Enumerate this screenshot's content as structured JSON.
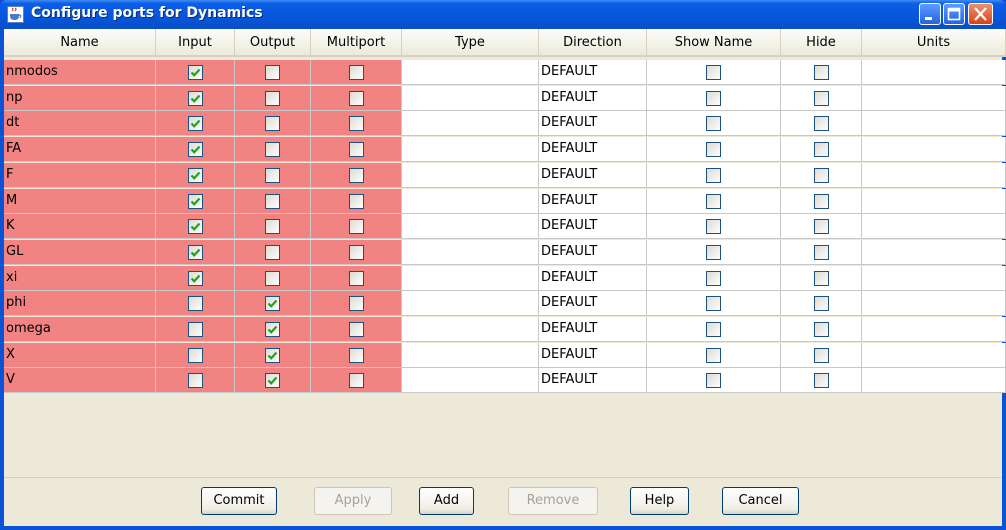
{
  "window": {
    "title": "Configure ports for Dynamics"
  },
  "columns": [
    "Name",
    "Input",
    "Output",
    "Multiport",
    "Type",
    "Direction",
    "Show Name",
    "Hide",
    "Units"
  ],
  "rows": [
    {
      "name": "nmodos",
      "input": true,
      "output": false,
      "multiport": false,
      "type": "",
      "direction": "DEFAULT",
      "show_name": false,
      "hide": false,
      "units": ""
    },
    {
      "name": "np",
      "input": true,
      "output": false,
      "multiport": false,
      "type": "",
      "direction": "DEFAULT",
      "show_name": false,
      "hide": false,
      "units": ""
    },
    {
      "name": "dt",
      "input": true,
      "output": false,
      "multiport": false,
      "type": "",
      "direction": "DEFAULT",
      "show_name": false,
      "hide": false,
      "units": ""
    },
    {
      "name": "FA",
      "input": true,
      "output": false,
      "multiport": false,
      "type": "",
      "direction": "DEFAULT",
      "show_name": false,
      "hide": false,
      "units": ""
    },
    {
      "name": "F",
      "input": true,
      "output": false,
      "multiport": false,
      "type": "",
      "direction": "DEFAULT",
      "show_name": false,
      "hide": false,
      "units": ""
    },
    {
      "name": "M",
      "input": true,
      "output": false,
      "multiport": false,
      "type": "",
      "direction": "DEFAULT",
      "show_name": false,
      "hide": false,
      "units": ""
    },
    {
      "name": "K",
      "input": true,
      "output": false,
      "multiport": false,
      "type": "",
      "direction": "DEFAULT",
      "show_name": false,
      "hide": false,
      "units": ""
    },
    {
      "name": "GL",
      "input": true,
      "output": false,
      "multiport": false,
      "type": "",
      "direction": "DEFAULT",
      "show_name": false,
      "hide": false,
      "units": ""
    },
    {
      "name": "xi",
      "input": true,
      "output": false,
      "multiport": false,
      "type": "",
      "direction": "DEFAULT",
      "show_name": false,
      "hide": false,
      "units": ""
    },
    {
      "name": "phi",
      "input": false,
      "output": true,
      "multiport": false,
      "type": "",
      "direction": "DEFAULT",
      "show_name": false,
      "hide": false,
      "units": ""
    },
    {
      "name": "omega",
      "input": false,
      "output": true,
      "multiport": false,
      "type": "",
      "direction": "DEFAULT",
      "show_name": false,
      "hide": false,
      "units": ""
    },
    {
      "name": "X",
      "input": false,
      "output": true,
      "multiport": false,
      "type": "",
      "direction": "DEFAULT",
      "show_name": false,
      "hide": false,
      "units": ""
    },
    {
      "name": "V",
      "input": false,
      "output": true,
      "multiport": false,
      "type": "",
      "direction": "DEFAULT",
      "show_name": false,
      "hide": false,
      "units": ""
    }
  ],
  "buttons": {
    "commit": "Commit",
    "apply": "Apply",
    "add": "Add",
    "remove": "Remove",
    "help": "Help",
    "cancel": "Cancel"
  },
  "colors": {
    "port_cell": "#f28383",
    "title_bar": "#0a58df",
    "check": "#21a121"
  }
}
